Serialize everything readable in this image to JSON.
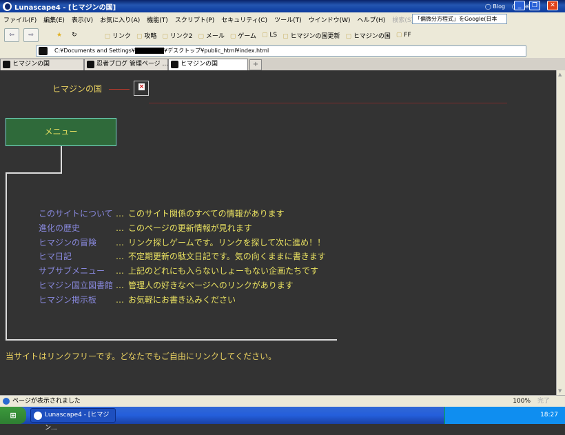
{
  "window": {
    "title": "Lunascape4 - [ヒマジンの国]",
    "blog": "Blog",
    "web": "Web"
  },
  "menubar": {
    "items": [
      "ファイル(F)",
      "編集(E)",
      "表示(V)",
      "お気に入り(A)",
      "機能(T)",
      "スクリプト(P)",
      "セキュリティ(C)",
      "ツール(T)",
      "ウインドウ(W)",
      "ヘルプ(H)"
    ],
    "search_label": "検索(S)",
    "search_value": "「偏微分方程式」をGoogle(日本"
  },
  "bookmarks": [
    "リンク",
    "攻略",
    "リンク2",
    "メール",
    "ゲーム",
    "LS",
    "ヒマジンの国更新",
    "ヒマジンの国",
    "FF"
  ],
  "address": {
    "prefix": "C:¥Documents and Settings¥",
    "suffix": "¥デスクトップ¥public_html¥index.html"
  },
  "tabs": [
    "ヒマジンの国",
    "忍者ブログ 管理ページ ...",
    "ヒマジンの国"
  ],
  "page": {
    "site_title": "ヒマジンの国",
    "menu_label": "メニュー",
    "links": [
      {
        "label": "このサイトについて",
        "desc": "このサイト関係のすべての情報があります"
      },
      {
        "label": "進化の歴史",
        "desc": "このページの更新情報が見れます"
      },
      {
        "label": "ヒマジンの冒険",
        "desc": "リンク探しゲームです。リンクを探して次に進め！！"
      },
      {
        "label": "ヒマ日記",
        "desc": "不定期更新の駄文日記です。気の向くままに書きます"
      },
      {
        "label": "サブサブメニュー",
        "desc": "上記のどれにも入らないしょーもない企画たちです"
      },
      {
        "label": "ヒマジン国立図書館",
        "desc": "管理人の好きなページへのリンクがあります"
      },
      {
        "label": "ヒマジン掲示板",
        "desc": "お気軽にお書き込みください"
      }
    ],
    "separator": "…",
    "footer": "当サイトはリンクフリーです。どなたでもご自由にリンクしてください。"
  },
  "status": {
    "text": "ページが表示されました",
    "zoom": "100%",
    "done": "完了"
  },
  "taskbar": {
    "task": "Lunascape4 - [ヒマジン...",
    "clock": "18:27"
  },
  "colors": {
    "page_bg": "#333333",
    "text_yellow": "#e8e060",
    "link": "#8888dd",
    "menu_bg": "#2f6a3a"
  }
}
